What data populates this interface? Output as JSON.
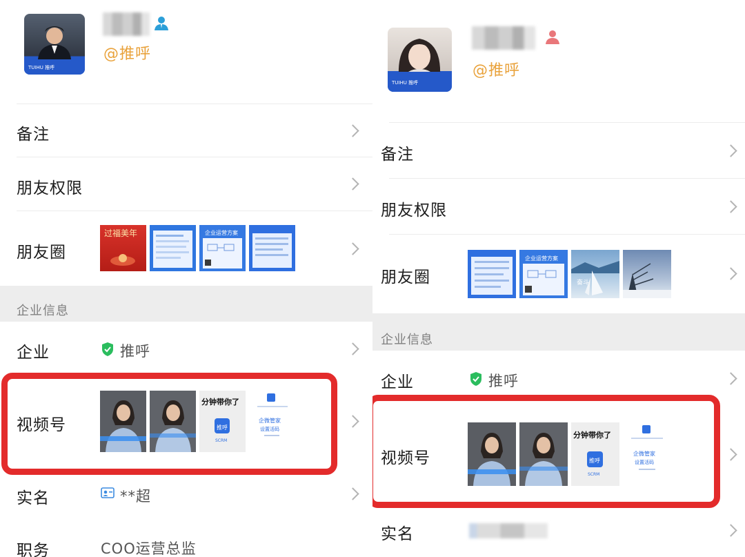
{
  "panels": [
    {
      "id": "left",
      "handle": "@推呼",
      "avatar_banner": "TUIHU 推呼",
      "rows": {
        "remark": "备注",
        "permission": "朋友权限",
        "moments": "朋友圈",
        "section": "企业信息",
        "company": "企业",
        "company_value": "推呼",
        "channels": "视频号",
        "realname": "实名",
        "realname_value": "**超",
        "title": "职务",
        "title_value": "COO运营总监"
      },
      "moments_thumbs": [
        "红色海报",
        "蓝色海报",
        "企业运营方案",
        "蓝色文章"
      ],
      "channel_thumbs": [
        "视频封面1",
        "视频封面2",
        "分钟带你了",
        "企微管家"
      ]
    },
    {
      "id": "right",
      "handle": "@推呼",
      "avatar_banner": "TUIHU 推呼",
      "rows": {
        "remark": "备注",
        "permission": "朋友权限",
        "moments": "朋友圈",
        "section": "企业信息",
        "company": "企业",
        "company_value": "推呼",
        "channels": "视频号",
        "realname": "实名"
      },
      "moments_thumbs": [
        "蓝色文章",
        "企业运营方案",
        "帆船",
        "冬景"
      ],
      "channel_thumbs": [
        "视频封面1",
        "视频封面2",
        "分钟带你了",
        "企微管家"
      ]
    }
  ],
  "thumb_text": {
    "red_poster": "过福美年",
    "plan_title": "企业运营方案",
    "minute_text": "分钟带你了",
    "logo_text": "推呼",
    "scrm": "SCRM",
    "guanjia_1": "企微管家",
    "guanjia_2": "设置活码",
    "sail_text": "奋斗"
  },
  "colors": {
    "highlight": "#e32b2b",
    "handle": "#e9a23b",
    "male_icon": "#2c9fd8",
    "female_icon": "#e9777a",
    "shield": "#2bbd5e",
    "brand_blue": "#2f6fe0"
  },
  "icons": {
    "person_male": "person-icon",
    "person_female": "person-icon",
    "verified": "shield-check-icon",
    "realname_card": "id-card-icon",
    "chevron": "chevron-right-icon"
  }
}
